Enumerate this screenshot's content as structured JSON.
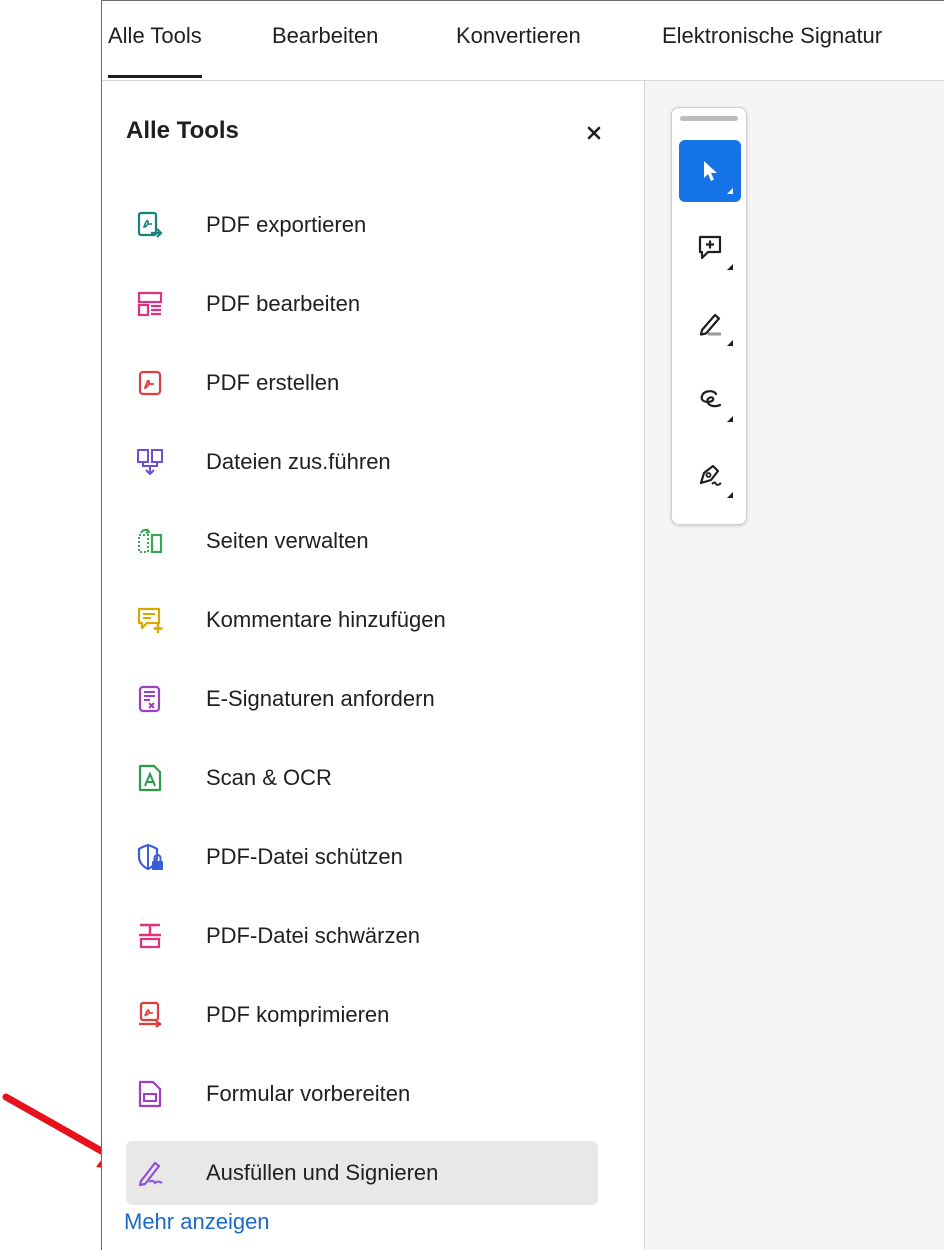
{
  "tabs": [
    {
      "label": "Alle Tools",
      "active": true
    },
    {
      "label": "Bearbeiten",
      "active": false
    },
    {
      "label": "Konvertieren",
      "active": false
    },
    {
      "label": "Elektronische Signatur",
      "active": false
    }
  ],
  "panel": {
    "title": "Alle Tools",
    "close_icon": "close-icon",
    "items": [
      {
        "label": "PDF exportieren",
        "icon": "export-pdf-icon",
        "color": "#15857c"
      },
      {
        "label": "PDF bearbeiten",
        "icon": "edit-pdf-icon",
        "color": "#e0307e"
      },
      {
        "label": "PDF erstellen",
        "icon": "create-pdf-icon",
        "color": "#e23b3b"
      },
      {
        "label": "Dateien zus.führen",
        "icon": "combine-files-icon",
        "color": "#6b4fd8"
      },
      {
        "label": "Seiten verwalten",
        "icon": "organize-pages-icon",
        "color": "#3aa655"
      },
      {
        "label": "Kommentare hinzufügen",
        "icon": "add-comment-icon",
        "color": "#d9a800"
      },
      {
        "label": "E-Signaturen anfordern",
        "icon": "request-esign-icon",
        "color": "#9b3fc8"
      },
      {
        "label": "Scan & OCR",
        "icon": "scan-ocr-icon",
        "color": "#2e9b4b"
      },
      {
        "label": "PDF-Datei schützen",
        "icon": "protect-pdf-icon",
        "color": "#3a5ed8"
      },
      {
        "label": "PDF-Datei schwärzen",
        "icon": "redact-pdf-icon",
        "color": "#e0307e"
      },
      {
        "label": "PDF komprimieren",
        "icon": "compress-pdf-icon",
        "color": "#e23b3b"
      },
      {
        "label": "Formular vorbereiten",
        "icon": "prepare-form-icon",
        "color": "#9b3fc8"
      },
      {
        "label": "Ausfüllen und Signieren",
        "icon": "fill-sign-icon",
        "color": "#8f4fd8",
        "selected": true
      }
    ],
    "more_link": "Mehr anzeigen"
  },
  "quick_toolbar": {
    "tools": [
      {
        "name": "select-tool",
        "icon": "cursor-icon",
        "active": true
      },
      {
        "name": "add-comment-tool",
        "icon": "comment-plus-icon",
        "active": false
      },
      {
        "name": "highlight-tool",
        "icon": "pen-highlight-icon",
        "active": false
      },
      {
        "name": "draw-tool",
        "icon": "lasso-draw-icon",
        "active": false
      },
      {
        "name": "sign-tool",
        "icon": "signature-pen-icon",
        "active": false
      }
    ]
  },
  "colors": {
    "accent": "#1473e6",
    "link": "#1b6ac9",
    "annotation_arrow": "#e8101a",
    "selected_row": "#e8e8e8"
  }
}
